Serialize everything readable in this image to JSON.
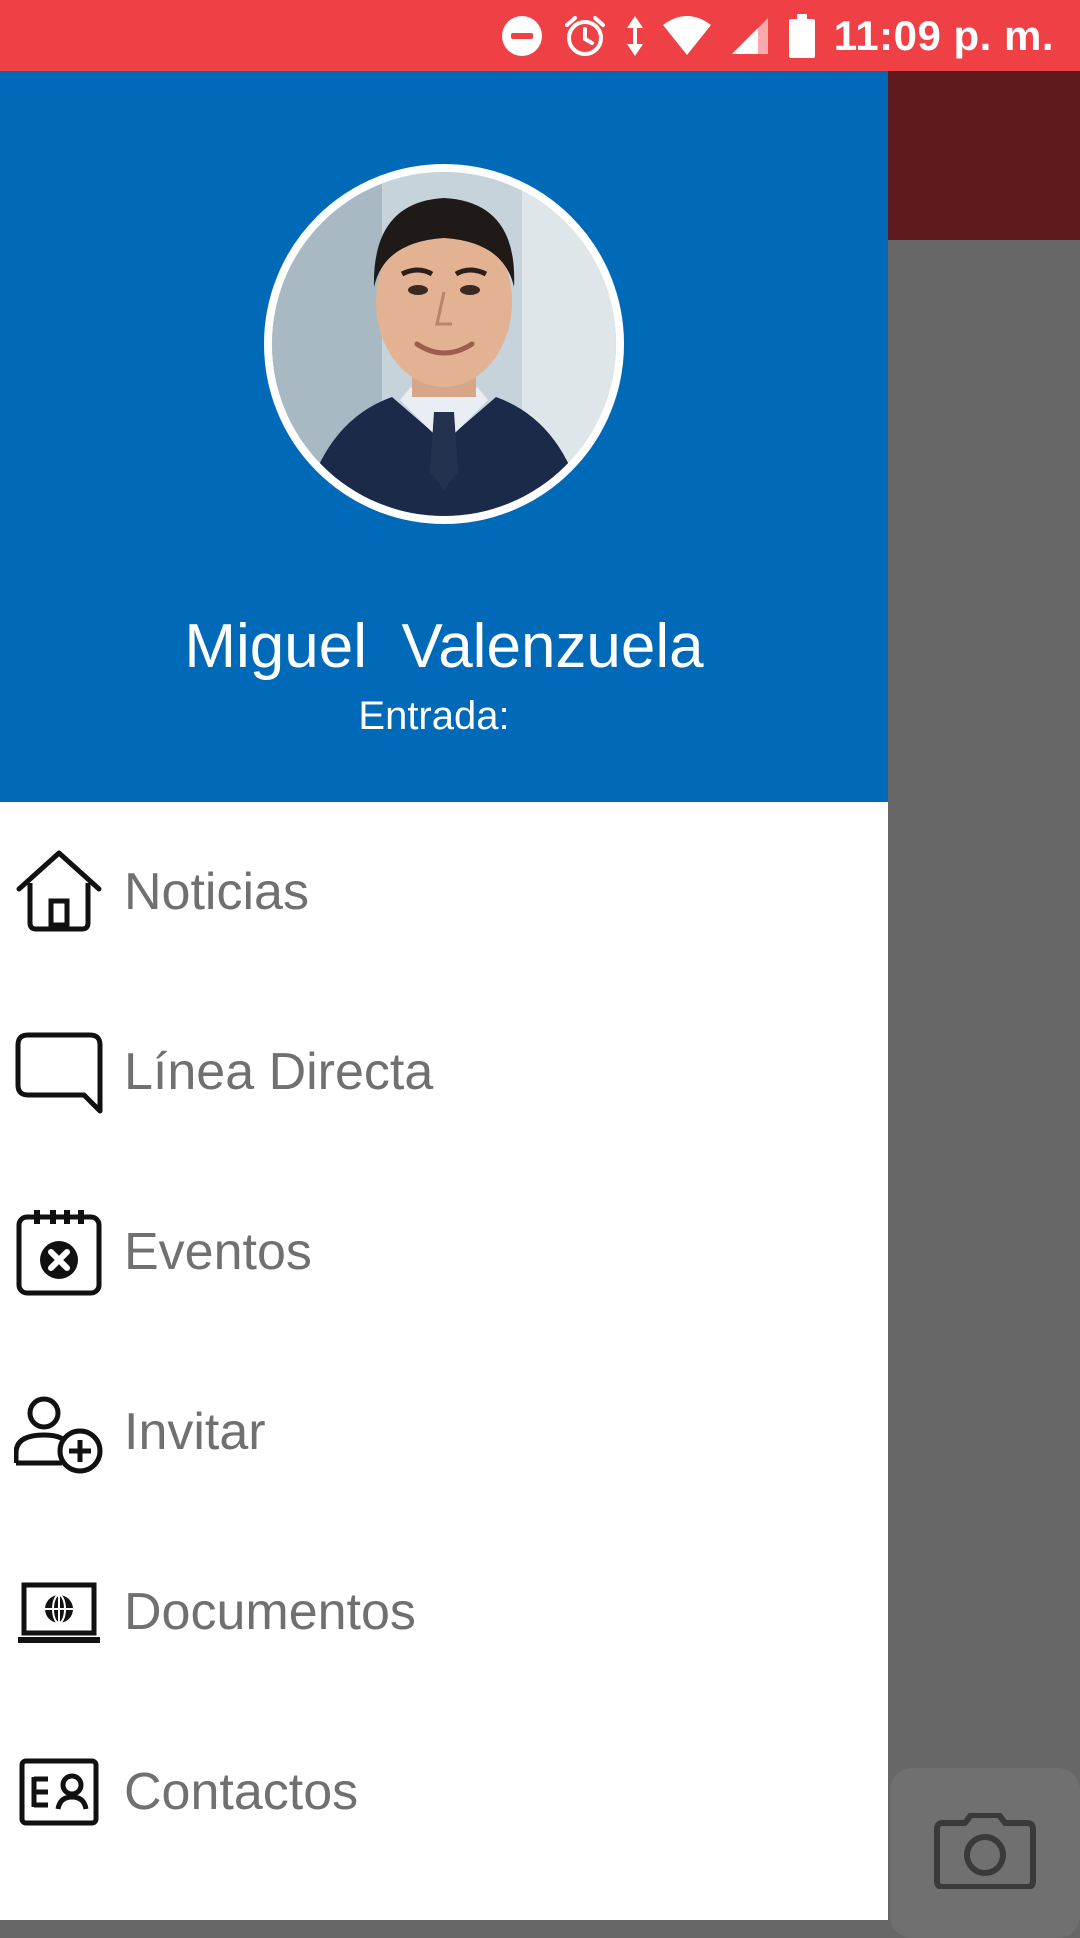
{
  "status_bar": {
    "time": "11:09 p. m.",
    "icons": [
      "do-not-disturb-icon",
      "alarm-icon",
      "data-arrows-icon",
      "wifi-icon",
      "signal-icon",
      "battery-icon"
    ],
    "background": "#ee4045"
  },
  "drawer": {
    "header_color": "#006ab8",
    "user": {
      "name": "Miguel  Valenzuela",
      "subtitle": "Entrada:"
    },
    "items": [
      {
        "label": "Noticias",
        "icon": "home-icon"
      },
      {
        "label": "Línea Directa",
        "icon": "chat-bubble-icon"
      },
      {
        "label": "Eventos",
        "icon": "calendar-icon"
      },
      {
        "label": "Invitar",
        "icon": "add-user-icon"
      },
      {
        "label": "Documentos",
        "icon": "laptop-globe-icon"
      },
      {
        "label": "Contactos",
        "icon": "contact-card-icon"
      }
    ]
  },
  "background_app": {
    "toolbar_color": "#5e1a1e",
    "scrim_color": "#676767",
    "fab_icon": "camera-icon"
  }
}
